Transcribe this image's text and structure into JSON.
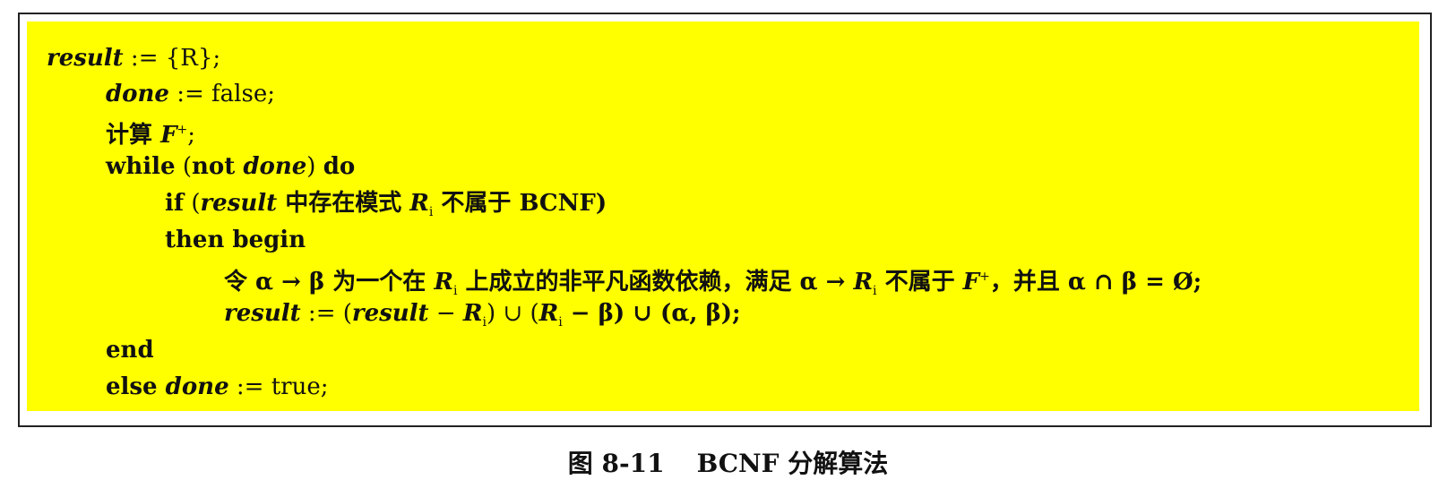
{
  "algorithm": {
    "line1": {
      "var": "result",
      "rest": " := {R};"
    },
    "line2": {
      "var": "done",
      "rest": " := false;"
    },
    "line3": {
      "text": "计算 ",
      "var": "F",
      "sup": "+",
      "tail": ";"
    },
    "line4": {
      "kw1": "while",
      "open": " (",
      "kw2": "not ",
      "var": "done",
      "close": ") ",
      "kw3": "do"
    },
    "line5": {
      "kw": "if",
      "open": " (",
      "var": "result",
      "text": " 中存在模式 ",
      "rvar": "R",
      "sub": "i",
      "tail": " 不属于 BCNF)"
    },
    "line6": {
      "kw": "then begin"
    },
    "line7": {
      "text1": "令 α → β 为一个在 ",
      "rvar": "R",
      "sub": "i",
      "text2": " 上成立的非平凡函数依赖，满足 α → ",
      "rvar2": "R",
      "sub2": "i",
      "text3": " 不属于 ",
      "fvar": "F",
      "sup": "+",
      "text4": "，并且 α ∩ β = Ø;"
    },
    "line8": {
      "var": "result",
      "text1": " := (",
      "var2": "result",
      "text2": " − ",
      "rvar": "R",
      "sub": "i",
      "text3": ") ∪ (",
      "rvar2": "R",
      "sub2": "i",
      "text4": " − β) ∪ (α, β);"
    },
    "line9": {
      "kw": "end"
    },
    "line10": {
      "kw": "else ",
      "var": "done",
      "rest": " := true;"
    }
  },
  "caption": {
    "label": "图 8-11",
    "title": "BCNF 分解算法"
  },
  "colors": {
    "highlight": "#ffff00",
    "border": "#222222"
  }
}
